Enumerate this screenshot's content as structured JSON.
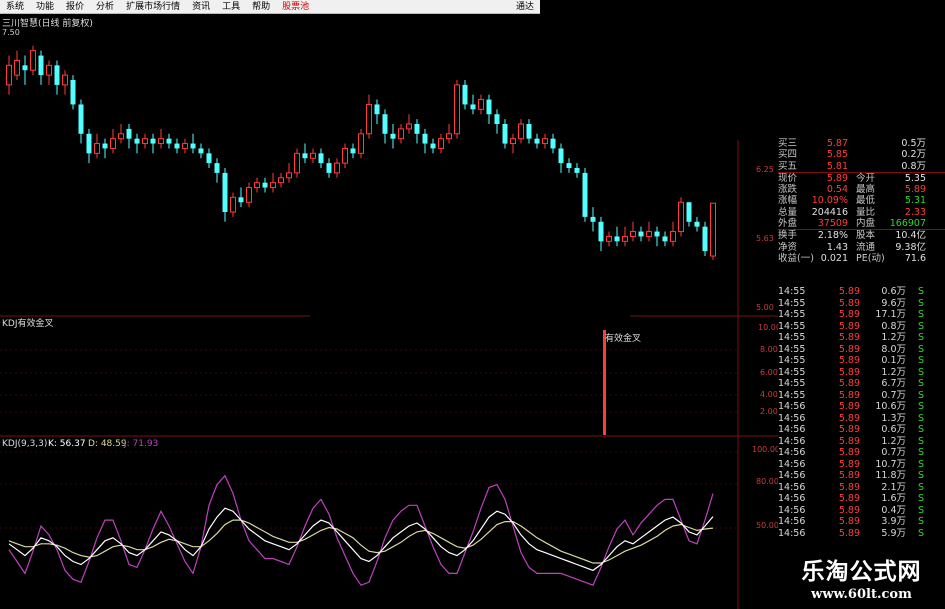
{
  "menu": {
    "items": [
      "系统",
      "功能",
      "报价",
      "分析",
      "扩展市场行情",
      "资讯",
      "工具",
      "帮助"
    ],
    "active_item": "股票池",
    "right_item": "通达"
  },
  "stock": {
    "title": "三川智慧(日线 前复权)",
    "price_tag": "7.50"
  },
  "price_axis": [
    "6.25",
    "5.63",
    "5.00"
  ],
  "indicator1": {
    "title": "KDJ有效金叉",
    "signal_label": "有效金叉",
    "axis": [
      "10.00",
      "8.00",
      "6.00",
      "4.00",
      "2.00"
    ]
  },
  "indicator2": {
    "name": "KDJ(9,3,3)",
    "k": "K: 56.37",
    "d": "D: 48.59",
    "j": "J: 71.93",
    "axis": [
      "100.00",
      "80.00",
      "50.00"
    ]
  },
  "quote": {
    "asks": [
      {
        "label": "买三",
        "price": "5.87",
        "vol": "0.5万"
      },
      {
        "label": "买四",
        "price": "5.85",
        "vol": "0.2万"
      },
      {
        "label": "买五",
        "price": "5.81",
        "vol": "0.8万"
      }
    ],
    "stats": [
      {
        "l1": "现价",
        "v1": "5.89",
        "c1": "red",
        "l2": "今开",
        "v2": "5.35",
        "c2": "white"
      },
      {
        "l1": "涨跌",
        "v1": "0.54",
        "c1": "red",
        "l2": "最高",
        "v2": "5.89",
        "c2": "red"
      },
      {
        "l1": "涨幅",
        "v1": "10.09%",
        "c1": "red",
        "l2": "最低",
        "v2": "5.31",
        "c2": "green"
      },
      {
        "l1": "总量",
        "v1": "204416",
        "c1": "white",
        "l2": "量比",
        "v2": "2.33",
        "c2": "red"
      },
      {
        "l1": "外盘",
        "v1": "37509",
        "c1": "red",
        "l2": "内盘",
        "v2": "166907",
        "c2": "green"
      }
    ],
    "stats2": [
      {
        "l1": "换手",
        "v1": "2.18%",
        "l2": "股本",
        "v2": "10.4亿"
      },
      {
        "l1": "净资",
        "v1": "1.43",
        "l2": "流通",
        "v2": "9.38亿"
      },
      {
        "l1": "收益(一)",
        "v1": "0.021",
        "l2": "PE(动)",
        "v2": "71.6"
      }
    ]
  },
  "ticks": [
    {
      "t": "14:55",
      "p": "5.89",
      "v": "0.6万",
      "s": "S"
    },
    {
      "t": "14:55",
      "p": "5.89",
      "v": "9.6万",
      "s": "S"
    },
    {
      "t": "14:55",
      "p": "5.89",
      "v": "17.1万",
      "s": "S"
    },
    {
      "t": "14:55",
      "p": "5.89",
      "v": "0.8万",
      "s": "S"
    },
    {
      "t": "14:55",
      "p": "5.89",
      "v": "1.2万",
      "s": "S"
    },
    {
      "t": "14:55",
      "p": "5.89",
      "v": "8.0万",
      "s": "S"
    },
    {
      "t": "14:55",
      "p": "5.89",
      "v": "0.1万",
      "s": "S"
    },
    {
      "t": "14:55",
      "p": "5.89",
      "v": "1.2万",
      "s": "S"
    },
    {
      "t": "14:55",
      "p": "5.89",
      "v": "6.7万",
      "s": "S"
    },
    {
      "t": "14:55",
      "p": "5.89",
      "v": "0.7万",
      "s": "S"
    },
    {
      "t": "14:56",
      "p": "5.89",
      "v": "10.6万",
      "s": "S"
    },
    {
      "t": "14:56",
      "p": "5.89",
      "v": "1.3万",
      "s": "S"
    },
    {
      "t": "14:56",
      "p": "5.89",
      "v": "0.6万",
      "s": "S"
    },
    {
      "t": "14:56",
      "p": "5.89",
      "v": "1.2万",
      "s": "S"
    },
    {
      "t": "14:56",
      "p": "5.89",
      "v": "0.7万",
      "s": "S"
    },
    {
      "t": "14:56",
      "p": "5.89",
      "v": "10.7万",
      "s": "S"
    },
    {
      "t": "14:56",
      "p": "5.89",
      "v": "11.8万",
      "s": "S"
    },
    {
      "t": "14:56",
      "p": "5.89",
      "v": "2.1万",
      "s": "S"
    },
    {
      "t": "14:56",
      "p": "5.89",
      "v": "1.6万",
      "s": "S"
    },
    {
      "t": "14:56",
      "p": "5.89",
      "v": "0.4万",
      "s": "S"
    },
    {
      "t": "14:56",
      "p": "5.89",
      "v": "3.9万",
      "s": "S"
    },
    {
      "t": "14:56",
      "p": "5.89",
      "v": "5.9万",
      "s": "S"
    }
  ],
  "watermark": {
    "text": "乐淘公式网",
    "url": "www.60lt.com"
  },
  "colors": {
    "up": "#ff3c3c",
    "down": "#54ffff",
    "k_line": "#ffffff",
    "d_line": "#d8d8a0",
    "j_line": "#c040c0",
    "grid": "#7a1010"
  },
  "chart_data": {
    "type": "candlestick",
    "ylim": [
      4.9,
      7.6
    ],
    "candles": [
      [
        7.1,
        7.3,
        7.4,
        7.0
      ],
      [
        7.2,
        7.35,
        7.45,
        7.15
      ],
      [
        7.3,
        7.25,
        7.4,
        7.1
      ],
      [
        7.25,
        7.45,
        7.5,
        7.2
      ],
      [
        7.4,
        7.2,
        7.45,
        7.1
      ],
      [
        7.2,
        7.3,
        7.35,
        7.1
      ],
      [
        7.3,
        7.1,
        7.35,
        7.0
      ],
      [
        7.1,
        7.2,
        7.25,
        7.0
      ],
      [
        7.15,
        6.9,
        7.2,
        6.85
      ],
      [
        6.9,
        6.6,
        6.95,
        6.5
      ],
      [
        6.6,
        6.4,
        6.65,
        6.3
      ],
      [
        6.4,
        6.5,
        6.6,
        6.35
      ],
      [
        6.5,
        6.45,
        6.55,
        6.35
      ],
      [
        6.45,
        6.55,
        6.65,
        6.4
      ],
      [
        6.55,
        6.6,
        6.7,
        6.5
      ],
      [
        6.65,
        6.55,
        6.7,
        6.45
      ],
      [
        6.55,
        6.5,
        6.6,
        6.4
      ],
      [
        6.5,
        6.55,
        6.6,
        6.45
      ],
      [
        6.55,
        6.5,
        6.6,
        6.4
      ],
      [
        6.5,
        6.55,
        6.65,
        6.45
      ],
      [
        6.55,
        6.5,
        6.6,
        6.45
      ],
      [
        6.5,
        6.45,
        6.55,
        6.4
      ],
      [
        6.45,
        6.5,
        6.55,
        6.4
      ],
      [
        6.5,
        6.45,
        6.6,
        6.4
      ],
      [
        6.45,
        6.4,
        6.5,
        6.35
      ],
      [
        6.4,
        6.3,
        6.45,
        6.25
      ],
      [
        6.3,
        6.2,
        6.35,
        6.1
      ],
      [
        6.2,
        5.8,
        6.25,
        5.7
      ],
      [
        5.8,
        5.95,
        6.0,
        5.75
      ],
      [
        5.95,
        5.9,
        6.05,
        5.85
      ],
      [
        5.9,
        6.05,
        6.1,
        5.85
      ],
      [
        6.05,
        6.1,
        6.15,
        6.0
      ],
      [
        6.1,
        6.05,
        6.15,
        6.0
      ],
      [
        6.05,
        6.1,
        6.2,
        6.0
      ],
      [
        6.1,
        6.15,
        6.2,
        6.05
      ],
      [
        6.15,
        6.2,
        6.3,
        6.1
      ],
      [
        6.2,
        6.4,
        6.45,
        6.15
      ],
      [
        6.4,
        6.35,
        6.5,
        6.3
      ],
      [
        6.35,
        6.4,
        6.45,
        6.3
      ],
      [
        6.4,
        6.3,
        6.45,
        6.25
      ],
      [
        6.3,
        6.2,
        6.35,
        6.15
      ],
      [
        6.2,
        6.3,
        6.35,
        6.15
      ],
      [
        6.3,
        6.45,
        6.5,
        6.25
      ],
      [
        6.45,
        6.4,
        6.5,
        6.35
      ],
      [
        6.4,
        6.6,
        6.65,
        6.35
      ],
      [
        6.6,
        6.9,
        7.0,
        6.55
      ],
      [
        6.9,
        6.8,
        6.95,
        6.7
      ],
      [
        6.8,
        6.6,
        6.85,
        6.5
      ],
      [
        6.6,
        6.55,
        6.7,
        6.45
      ],
      [
        6.55,
        6.65,
        6.7,
        6.5
      ],
      [
        6.65,
        6.7,
        6.8,
        6.6
      ],
      [
        6.7,
        6.6,
        6.75,
        6.5
      ],
      [
        6.6,
        6.5,
        6.65,
        6.4
      ],
      [
        6.5,
        6.45,
        6.55,
        6.4
      ],
      [
        6.45,
        6.55,
        6.6,
        6.4
      ],
      [
        6.55,
        6.6,
        6.7,
        6.5
      ],
      [
        6.6,
        7.1,
        7.15,
        6.55
      ],
      [
        7.1,
        6.9,
        7.15,
        6.85
      ],
      [
        6.9,
        6.85,
        7.0,
        6.8
      ],
      [
        6.85,
        6.95,
        7.0,
        6.8
      ],
      [
        6.95,
        6.8,
        7.0,
        6.7
      ],
      [
        6.8,
        6.7,
        6.85,
        6.6
      ],
      [
        6.7,
        6.5,
        6.75,
        6.45
      ],
      [
        6.5,
        6.55,
        6.6,
        6.4
      ],
      [
        6.55,
        6.7,
        6.75,
        6.5
      ],
      [
        6.7,
        6.55,
        6.75,
        6.5
      ],
      [
        6.55,
        6.5,
        6.6,
        6.45
      ],
      [
        6.5,
        6.55,
        6.6,
        6.45
      ],
      [
        6.55,
        6.45,
        6.6,
        6.4
      ],
      [
        6.45,
        6.3,
        6.5,
        6.2
      ],
      [
        6.3,
        6.25,
        6.35,
        6.2
      ],
      [
        6.25,
        6.2,
        6.3,
        6.15
      ],
      [
        6.2,
        5.75,
        6.25,
        5.7
      ],
      [
        5.75,
        5.7,
        5.85,
        5.6
      ],
      [
        5.7,
        5.5,
        5.75,
        5.4
      ],
      [
        5.5,
        5.55,
        5.6,
        5.45
      ],
      [
        5.55,
        5.5,
        5.65,
        5.45
      ],
      [
        5.5,
        5.55,
        5.65,
        5.45
      ],
      [
        5.55,
        5.6,
        5.7,
        5.5
      ],
      [
        5.6,
        5.55,
        5.65,
        5.5
      ],
      [
        5.55,
        5.6,
        5.7,
        5.5
      ],
      [
        5.6,
        5.55,
        5.65,
        5.45
      ],
      [
        5.55,
        5.5,
        5.6,
        5.45
      ],
      [
        5.5,
        5.6,
        5.7,
        5.45
      ],
      [
        5.6,
        5.9,
        5.95,
        5.55
      ],
      [
        5.9,
        5.7,
        5.9,
        5.65
      ],
      [
        5.7,
        5.65,
        5.75,
        5.6
      ],
      [
        5.65,
        5.4,
        5.7,
        5.35
      ],
      [
        5.35,
        5.89,
        5.89,
        5.31
      ]
    ],
    "indicator1_signal_index": 76,
    "kdj_k": [
      38,
      34,
      30,
      35,
      42,
      40,
      36,
      30,
      26,
      24,
      28,
      34,
      40,
      42,
      38,
      32,
      30,
      34,
      40,
      46,
      44,
      40,
      34,
      30,
      36,
      48,
      56,
      62,
      60,
      54,
      48,
      44,
      40,
      38,
      36,
      34,
      38,
      44,
      50,
      54,
      52,
      46,
      40,
      34,
      28,
      26,
      30,
      36,
      42,
      46,
      50,
      52,
      48,
      42,
      36,
      32,
      30,
      34,
      40,
      48,
      56,
      60,
      58,
      52,
      44,
      38,
      34,
      32,
      30,
      28,
      26,
      24,
      22,
      20,
      24,
      30,
      36,
      40,
      38,
      42,
      46,
      50,
      54,
      56,
      52,
      46,
      44,
      50,
      56.37
    ],
    "kdj_d": [
      40,
      38,
      36,
      36,
      38,
      38,
      37,
      35,
      32,
      30,
      29,
      30,
      33,
      36,
      37,
      36,
      34,
      34,
      36,
      39,
      41,
      40,
      38,
      36,
      36,
      40,
      45,
      51,
      54,
      54,
      52,
      49,
      46,
      43,
      41,
      39,
      39,
      41,
      44,
      47,
      49,
      48,
      45,
      42,
      37,
      33,
      32,
      33,
      36,
      39,
      43,
      46,
      47,
      45,
      42,
      39,
      36,
      35,
      37,
      41,
      46,
      51,
      53,
      53,
      50,
      46,
      42,
      39,
      36,
      33,
      31,
      29,
      27,
      25,
      25,
      27,
      30,
      33,
      35,
      37,
      40,
      43,
      47,
      50,
      51,
      49,
      47,
      48,
      48.59
    ],
    "kdj_j": [
      34,
      26,
      18,
      33,
      50,
      44,
      34,
      20,
      14,
      12,
      26,
      42,
      54,
      54,
      40,
      24,
      22,
      34,
      48,
      60,
      50,
      38,
      26,
      18,
      36,
      64,
      78,
      84,
      72,
      54,
      40,
      34,
      28,
      28,
      26,
      24,
      36,
      50,
      62,
      68,
      58,
      42,
      30,
      18,
      10,
      12,
      26,
      42,
      54,
      60,
      64,
      64,
      50,
      36,
      24,
      18,
      18,
      32,
      46,
      62,
      76,
      78,
      68,
      50,
      32,
      22,
      18,
      18,
      18,
      18,
      16,
      14,
      12,
      10,
      22,
      36,
      48,
      54,
      44,
      52,
      58,
      64,
      68,
      68,
      54,
      40,
      38,
      54,
      71.93
    ]
  }
}
